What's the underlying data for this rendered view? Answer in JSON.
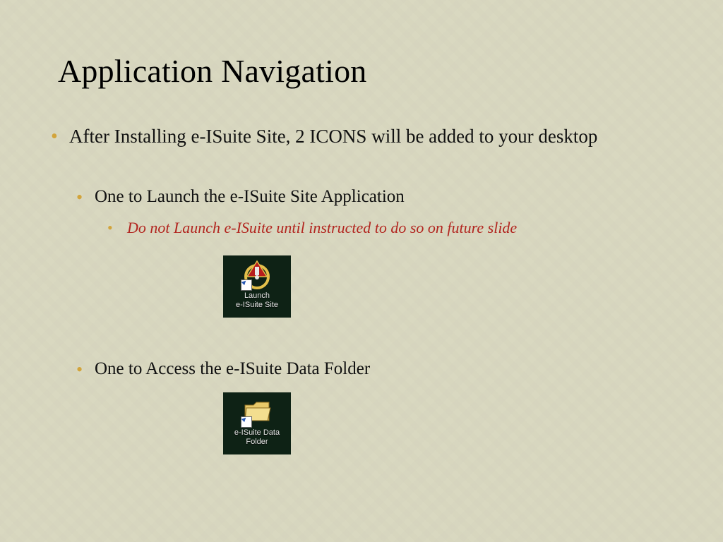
{
  "title": "Application Navigation",
  "bullet1": "After Installing e-ISuite Site, 2 ICONS will be added to your desktop",
  "bullet1_sub1": "One to Launch the e-ISuite Site Application",
  "bullet1_sub1_warn": "Do not Launch e-ISuite until instructed to do so on future slide",
  "bullet1_sub2": "One to Access the e-ISuite Data Folder",
  "icons": {
    "launch": {
      "caption_line1": "Launch",
      "caption_line2": "e-ISuite Site"
    },
    "folder": {
      "caption_line1": "e-ISuite Data",
      "caption_line2": "Folder"
    }
  }
}
